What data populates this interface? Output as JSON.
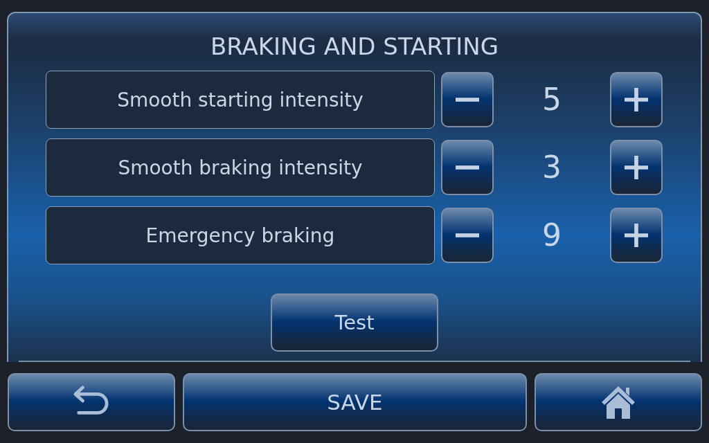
{
  "screen": {
    "title": "BRAKING AND STARTING"
  },
  "settings": [
    {
      "label": "Smooth starting intensity",
      "value": "5"
    },
    {
      "label": "Smooth braking intensity",
      "value": "3"
    },
    {
      "label": "Emergency braking",
      "value": "9"
    }
  ],
  "test_button": {
    "label": "Test"
  },
  "footer": {
    "buttons": [
      {
        "kind": "back"
      },
      {
        "kind": "save",
        "label": "SAVE"
      },
      {
        "kind": "home"
      }
    ]
  }
}
